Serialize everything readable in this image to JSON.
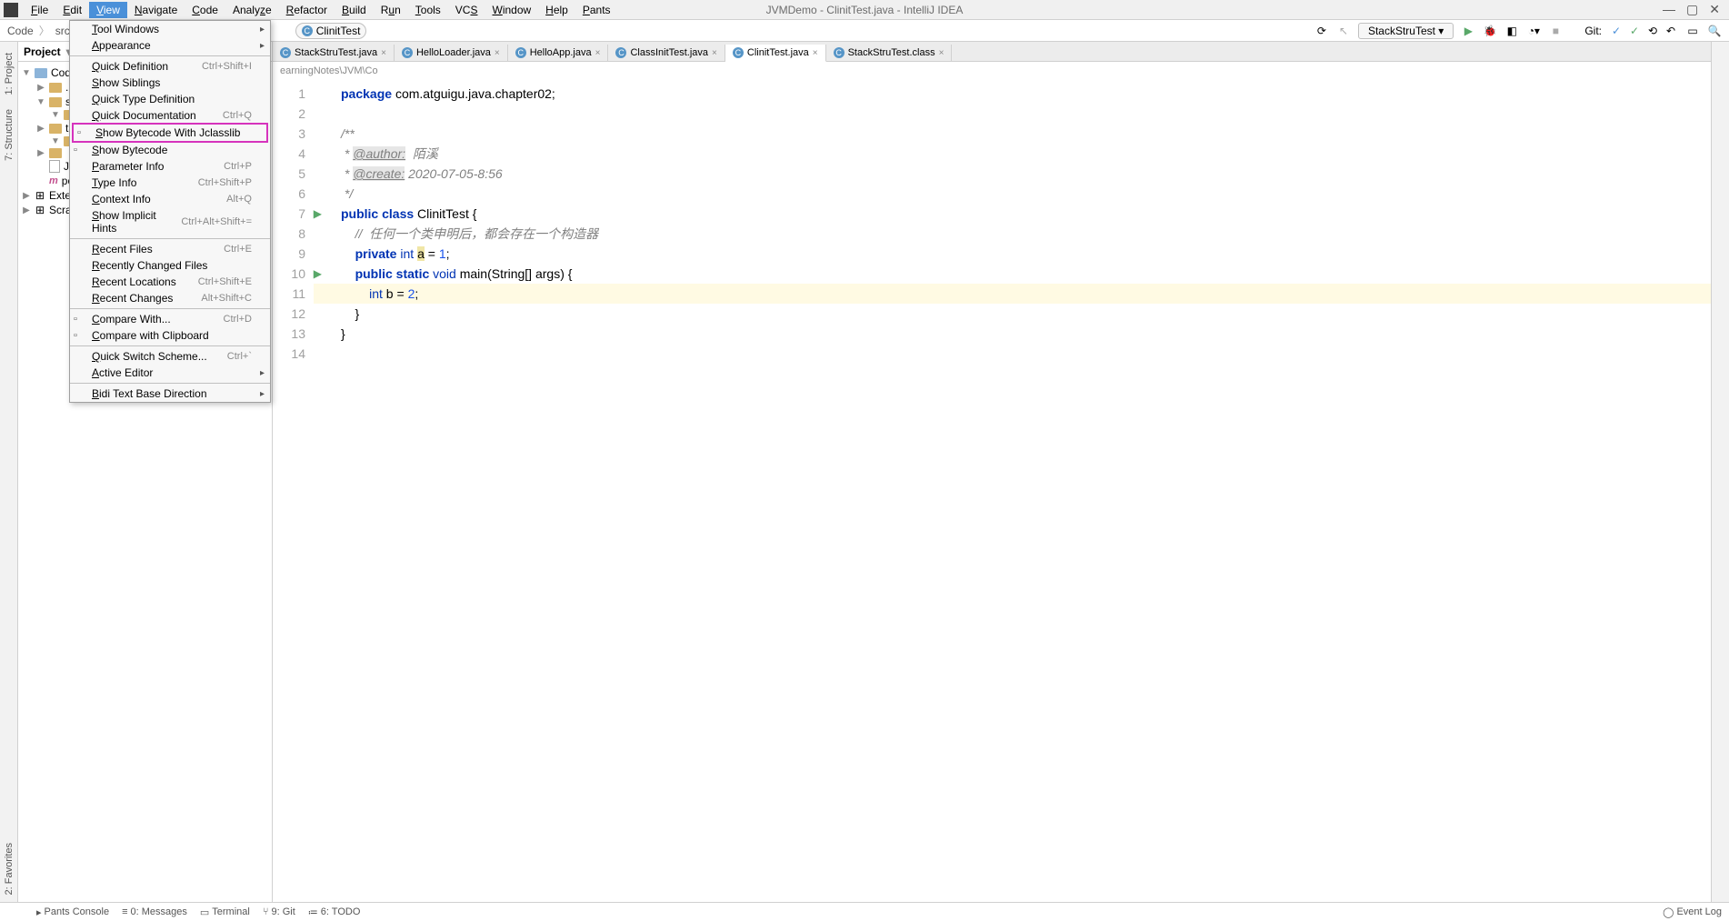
{
  "window": {
    "title": "JVMDemo - ClinitTest.java - IntelliJ IDEA"
  },
  "menubar": {
    "items": [
      "File",
      "Edit",
      "View",
      "Navigate",
      "Code",
      "Analyze",
      "Refactor",
      "Build",
      "Run",
      "Tools",
      "VCS",
      "Window",
      "Help",
      "Pants"
    ],
    "active": "View"
  },
  "breadcrumb": {
    "items": [
      "Code",
      "src"
    ],
    "nav_class": "ClinitTest",
    "run_config": "StackStruTest",
    "git_label": "Git:"
  },
  "view_menu": {
    "groups": [
      [
        {
          "label": "Tool Windows",
          "submenu": true
        },
        {
          "label": "Appearance",
          "submenu": true
        }
      ],
      [
        {
          "label": "Quick Definition",
          "shortcut": "Ctrl+Shift+I"
        },
        {
          "label": "Show Siblings"
        },
        {
          "label": "Quick Type Definition"
        },
        {
          "label": "Quick Documentation",
          "shortcut": "Ctrl+Q"
        },
        {
          "label": "Show Bytecode With Jclasslib",
          "highlighted": true,
          "icon": "jc"
        },
        {
          "label": "Show Bytecode",
          "icon": "01"
        },
        {
          "label": "Parameter Info",
          "shortcut": "Ctrl+P"
        },
        {
          "label": "Type Info",
          "shortcut": "Ctrl+Shift+P"
        },
        {
          "label": "Context Info",
          "shortcut": "Alt+Q"
        },
        {
          "label": "Show Implicit Hints",
          "shortcut": "Ctrl+Alt+Shift+="
        }
      ],
      [
        {
          "label": "Recent Files",
          "shortcut": "Ctrl+E"
        },
        {
          "label": "Recently Changed Files"
        },
        {
          "label": "Recent Locations",
          "shortcut": "Ctrl+Shift+E"
        },
        {
          "label": "Recent Changes",
          "shortcut": "Alt+Shift+C"
        }
      ],
      [
        {
          "label": "Compare With...",
          "shortcut": "Ctrl+D",
          "icon": "cmp"
        },
        {
          "label": "Compare with Clipboard",
          "icon": "cmp"
        }
      ],
      [
        {
          "label": "Quick Switch Scheme...",
          "shortcut": "Ctrl+`"
        },
        {
          "label": "Active Editor",
          "submenu": true
        }
      ],
      [
        {
          "label": "Bidi Text Base Direction",
          "submenu": true
        }
      ]
    ]
  },
  "project_tree": {
    "header": "Project",
    "nodes": [
      {
        "indent": 0,
        "arrow": "▼",
        "icon": "module",
        "label": "Code"
      },
      {
        "indent": 1,
        "arrow": "▶",
        "icon": "folder",
        "label": ".ide"
      },
      {
        "indent": 1,
        "arrow": "▼",
        "icon": "folder",
        "label": "src"
      },
      {
        "indent": 2,
        "arrow": "▼",
        "icon": "folder",
        "label": ""
      },
      {
        "indent": 1,
        "arrow": "▶",
        "icon": "folder",
        "label": "tar"
      },
      {
        "indent": 2,
        "arrow": "▼",
        "icon": "folder",
        "label": ""
      },
      {
        "indent": 1,
        "arrow": "▶",
        "icon": "folder",
        "label": ""
      },
      {
        "indent": 1,
        "arrow": "",
        "icon": "file",
        "label": "JVI"
      },
      {
        "indent": 1,
        "arrow": "",
        "icon": "pom",
        "label": "pom.xml"
      },
      {
        "indent": 0,
        "arrow": "▶",
        "icon": "lib",
        "label": "External Libraries"
      },
      {
        "indent": 0,
        "arrow": "▶",
        "icon": "scratch",
        "label": "Scratches and Consoles"
      }
    ]
  },
  "tabs": [
    {
      "name": "StackStruTest.java",
      "active": false
    },
    {
      "name": "HelloLoader.java",
      "active": false
    },
    {
      "name": "HelloApp.java",
      "active": false
    },
    {
      "name": "ClassInitTest.java",
      "active": false
    },
    {
      "name": "ClinitTest.java",
      "active": true
    },
    {
      "name": "StackStruTest.class",
      "active": false
    }
  ],
  "editor_breadcrumb": "earningNotes\\JVM\\Co",
  "code": {
    "lines": [
      {
        "n": 1,
        "html": "<span class='kw'>package</span> <span class='pkg'>com.atguigu.java.chapter02;</span>"
      },
      {
        "n": 2,
        "html": ""
      },
      {
        "n": 3,
        "html": "<span class='doc'>/**</span>"
      },
      {
        "n": 4,
        "html": "<span class='doc'> * </span><span class='doc-tag'>@author:</span><span class='doc'>  陌溪</span>"
      },
      {
        "n": 5,
        "html": "<span class='doc'> * </span><span class='doc-tag'>@create:</span><span class='doc'> 2020-07-05-8:56</span>"
      },
      {
        "n": 6,
        "html": "<span class='doc'> */</span>"
      },
      {
        "n": 7,
        "html": "<span class='kw'>public class</span> <span class='cls'>ClinitTest</span> {",
        "run": true
      },
      {
        "n": 8,
        "html": "    <span class='cmt'>//  任何一个类申明后，都会存在一个构造器</span>"
      },
      {
        "n": 9,
        "html": "    <span class='kw'>private</span> <span class='kw2'>int</span> <span class='warn-bg'>a</span> = <span class='num'>1</span>;"
      },
      {
        "n": 10,
        "html": "    <span class='kw'>public static</span> <span class='kw2'>void</span> main(String[] args) {",
        "run": true
      },
      {
        "n": 11,
        "html": "        <span class='kw2'>int</span> b = <span class='num'>2</span>;",
        "highlight": true
      },
      {
        "n": 12,
        "html": "    }"
      },
      {
        "n": 13,
        "html": "}"
      },
      {
        "n": 14,
        "html": ""
      }
    ]
  },
  "left_tabs": {
    "project": "1: Project",
    "structure": "7: Structure",
    "favorites": "2: Favorites"
  },
  "status": {
    "pants": "Pants Console",
    "messages": "0: Messages",
    "terminal": "Terminal",
    "git": "9: Git",
    "todo": "6: TODO",
    "event_log": "Event Log"
  }
}
